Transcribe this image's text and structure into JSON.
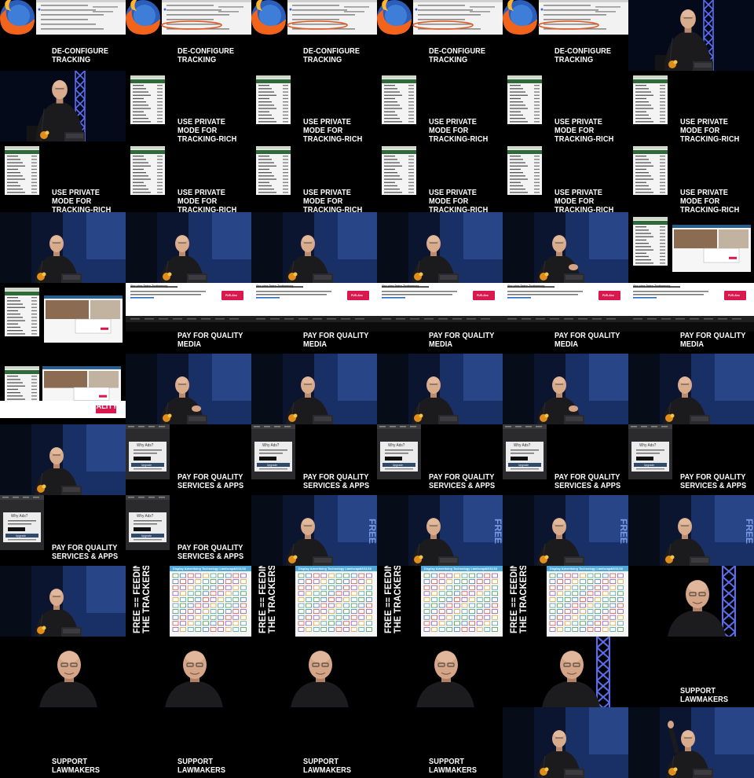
{
  "sheet": {
    "columns": 6,
    "rows": 11,
    "captions": {
      "deconfigure": "DE-CONFIGURE\nTRACKING",
      "private": "USE PRIVATE MODE FOR\nTRACKING-RICH MEDIA",
      "quality_media": "PAY FOR QUALITY MEDIA",
      "quality_services": "PAY FOR QUALITY\nSERVICES & APPS",
      "free_1": "FREE == FEEDING",
      "free_2": "THE TRACKERS",
      "lawmakers": "SUPPORT LAWMAKERS"
    },
    "screen_text": {
      "ads_heading": "Why Ads?",
      "ads_button": "Upgrade",
      "web_popup_title": "Abo ohne Daten-Zustimmung",
      "web_popup_button": "PUR-Abo",
      "chart_title": "Display Advertising Technology Landscape",
      "chart_date": "12/31/16"
    },
    "frames": [
      "firefox",
      "firefox-ring",
      "firefox-ring",
      "firefox-ring",
      "firefox-ring",
      "stage-truss",
      "stage-truss",
      "menu",
      "menu",
      "menu",
      "menu",
      "menu",
      "menu",
      "menu",
      "menu",
      "menu",
      "menu",
      "menu",
      "speaker",
      "speaker",
      "speaker",
      "speaker",
      "speaker-hand",
      "menu-web",
      "menu-web",
      "web",
      "web",
      "web",
      "web",
      "web",
      "web-small",
      "speaker-hand",
      "speaker",
      "speaker",
      "speaker-hand",
      "speaker",
      "speaker",
      "ads",
      "ads",
      "ads",
      "ads",
      "ads",
      "ads-small",
      "ads-small",
      "speaker-free",
      "speaker-free",
      "speaker-free",
      "speaker-free",
      "speaker",
      "landscape",
      "landscape",
      "landscape",
      "landscape",
      "closeup-truss",
      "closeup",
      "closeup",
      "closeup",
      "closeup",
      "closeup-truss",
      "caption-only",
      "caption-only",
      "caption-only",
      "caption-only",
      "caption-only",
      "speaker",
      "speaker-wave"
    ],
    "frame_captions": [
      "deconfigure",
      "deconfigure",
      "deconfigure",
      "deconfigure",
      "deconfigure",
      "",
      "",
      "private",
      "private",
      "private",
      "private",
      "private",
      "private",
      "private",
      "private",
      "private",
      "private",
      "private",
      "",
      "",
      "",
      "",
      "",
      "",
      "",
      "quality_media",
      "quality_media",
      "quality_media",
      "quality_media",
      "quality_media",
      "quality_media",
      "",
      "",
      "",
      "",
      "",
      "",
      "quality_services",
      "quality_services",
      "quality_services",
      "quality_services",
      "quality_services",
      "quality_services",
      "quality_services",
      "",
      "",
      "",
      "",
      "",
      "free",
      "free",
      "free",
      "free",
      "",
      "",
      "",
      "",
      "",
      "",
      "lawmakers",
      "lawmakers",
      "lawmakers",
      "lawmakers",
      "lawmakers",
      "",
      ""
    ]
  }
}
